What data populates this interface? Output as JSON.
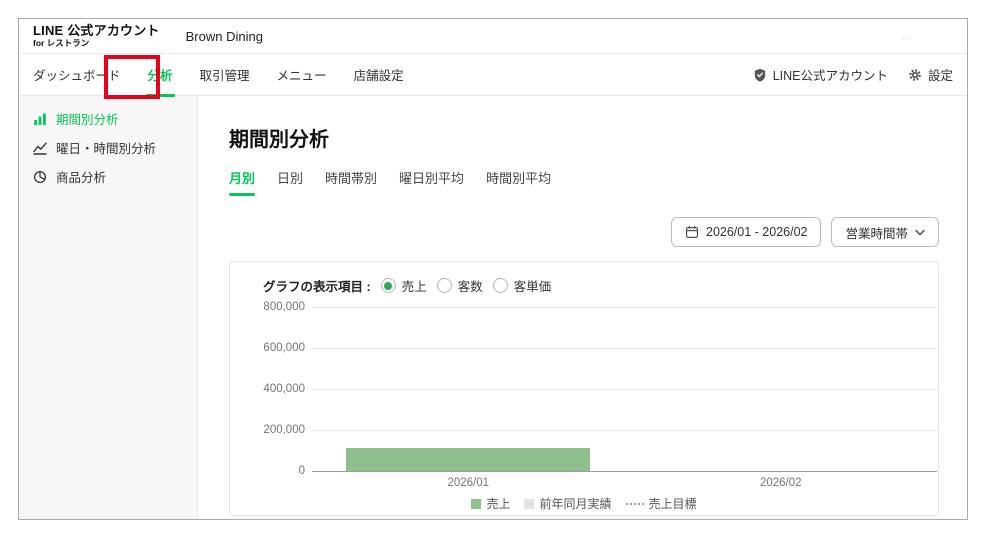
{
  "colors": {
    "brand_green": "#06c755",
    "bar_green": "#8dc08d",
    "prev_year_gray": "#e3e3e3",
    "annotation_red": "#e8001c",
    "axis_text": "#767676"
  },
  "header": {
    "logo_line1": "LINE 公式アカウント",
    "logo_line2": "for レストラン",
    "account_name": "Brown Dining",
    "ellipsis": "…"
  },
  "nav": {
    "items": [
      {
        "label": "ダッシュボード",
        "active": false
      },
      {
        "label": "分析",
        "active": true,
        "annotated": true
      },
      {
        "label": "取引管理",
        "active": false
      },
      {
        "label": "メニュー",
        "active": false
      },
      {
        "label": "店舗設定",
        "active": false
      }
    ],
    "right_items": [
      {
        "label": "LINE公式アカウント",
        "icon": "shield-icon"
      },
      {
        "label": "設定",
        "icon": "gear-icon"
      }
    ]
  },
  "sidebar": {
    "items": [
      {
        "label": "期間別分析",
        "icon": "bar-chart-icon",
        "active": true
      },
      {
        "label": "曜日・時間別分析",
        "icon": "line-chart-icon",
        "active": false
      },
      {
        "label": "商品分析",
        "icon": "pie-chart-icon",
        "active": false
      }
    ]
  },
  "main": {
    "title": "期間別分析",
    "tabs": [
      {
        "label": "月別",
        "active": true
      },
      {
        "label": "日別",
        "active": false
      },
      {
        "label": "時間帯別",
        "active": false
      },
      {
        "label": "曜日別平均",
        "active": false
      },
      {
        "label": "時間別平均",
        "active": false
      }
    ],
    "date_range_button_label": "2026/01 - 2026/02",
    "hours_dropdown_label": "営業時間帯",
    "metric_selector_label": "グラフの表示項目 :",
    "metric_options": [
      {
        "label": "売上",
        "selected": true
      },
      {
        "label": "客数",
        "selected": false
      },
      {
        "label": "客単価",
        "selected": false
      }
    ]
  },
  "chart_data": {
    "type": "bar",
    "title": "",
    "xlabel": "",
    "ylabel": "",
    "categories": [
      "2026/01",
      "2026/02"
    ],
    "series": [
      {
        "name": "売上",
        "values": [
          110000,
          0
        ],
        "color": "#8dc08d",
        "marker": "square"
      },
      {
        "name": "前年同月実績",
        "values": [
          null,
          null
        ],
        "color": "#e3e3e3",
        "marker": "square"
      },
      {
        "name": "売上目標",
        "values": [
          null,
          null
        ],
        "color": "#a3a3a3",
        "marker": "dotted-line"
      }
    ],
    "ylim": [
      0,
      800000
    ],
    "yticks": [
      0,
      200000,
      400000,
      600000,
      800000
    ],
    "grid": true,
    "legend_position": "bottom"
  }
}
